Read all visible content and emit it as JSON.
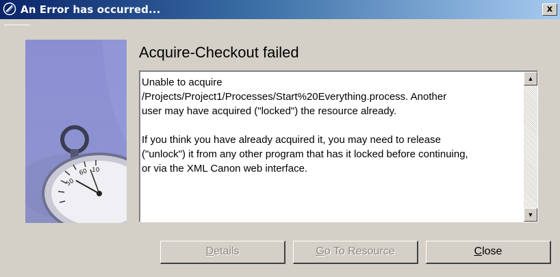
{
  "window": {
    "title": "An Error has occurred...",
    "close_glyph": "x"
  },
  "dialog": {
    "heading": "Acquire-Checkout failed",
    "message_paragraph_1_lines": [
      "Unable to acquire",
      "/Projects/Project1/Processes/Start%20Everything.process.  Another",
      "user may have acquired (\"locked\") the resource already."
    ],
    "message_paragraph_2_lines": [
      "If you think you have already acquired it, you may need to release",
      "(\"unlock\") it from any other program that has it locked before continuing,",
      "or via the XML Canon web interface."
    ],
    "scroll_up_glyph": "▲",
    "scroll_down_glyph": "▼"
  },
  "buttons": {
    "details": {
      "mnemonic": "D",
      "rest": "etails",
      "enabled": false
    },
    "go_to_resource": {
      "mnemonic": "G",
      "rest": "o To Resource",
      "enabled": false
    },
    "close": {
      "mnemonic": "C",
      "rest": "lose",
      "enabled": true
    }
  },
  "graphic": {
    "icon": "stopwatch-illustration"
  },
  "colors": {
    "title_start": "#0a246a",
    "title_end": "#a6caf0",
    "dialog_bg": "#d4d0c8",
    "graphic_bg": "#8d93d1"
  }
}
